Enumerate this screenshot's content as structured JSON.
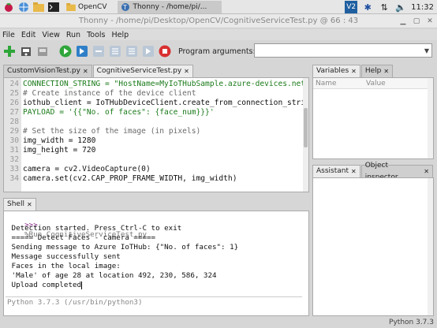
{
  "taskbar": {
    "tasks": [
      {
        "label": "OpenCV"
      },
      {
        "label": "Thonny  -  /home/pi/..."
      }
    ],
    "clock": "11:32"
  },
  "window": {
    "title": "Thonny  -  /home/pi/Desktop/OpenCV/CognitiveServiceTest.py  @  66 : 43"
  },
  "menu": [
    "File",
    "Edit",
    "View",
    "Run",
    "Tools",
    "Help"
  ],
  "toolbar": {
    "program_args_label": "Program arguments:",
    "program_args_value": ""
  },
  "editor": {
    "tabs": [
      {
        "label": "CustomVisionTest.py",
        "active": false
      },
      {
        "label": "CognitiveServiceTest.py",
        "active": true
      }
    ],
    "lines": [
      {
        "n": "24",
        "text": "CONNECTION_STRING = \"HostName=MyIoTHubSample.azure-devices.net;D",
        "kind": "string"
      },
      {
        "n": "25",
        "text": "# Create instance of the device client",
        "kind": "comment"
      },
      {
        "n": "26",
        "text": "iothub_client = IoTHubDeviceClient.create_from_connection_string",
        "kind": "default"
      },
      {
        "n": "27",
        "text": "PAYLOAD = '{{\"No. of faces\": {face_num}}}'",
        "kind": "string"
      },
      {
        "n": "28",
        "text": "",
        "kind": "default"
      },
      {
        "n": "29",
        "text": "# Set the size of the image (in pixels)",
        "kind": "comment"
      },
      {
        "n": "30",
        "text": "img_width = 1280",
        "kind": "default"
      },
      {
        "n": "31",
        "text": "img_height = 720",
        "kind": "default"
      },
      {
        "n": "32",
        "text": "",
        "kind": "default"
      },
      {
        "n": "33",
        "text": "camera = cv2.VideoCapture(0)",
        "kind": "default"
      },
      {
        "n": "34",
        "text": "camera.set(cv2.CAP_PROP_FRAME_WIDTH, img_width)",
        "kind": "default"
      }
    ]
  },
  "variables": {
    "tabs": [
      {
        "label": "Variables"
      },
      {
        "label": "Help"
      }
    ],
    "columns": [
      "Name",
      "Value"
    ]
  },
  "assistant": {
    "tabs": [
      {
        "label": "Assistant"
      },
      {
        "label": "Object inspector"
      }
    ]
  },
  "shell": {
    "tab": "Shell",
    "prompt": ">>>",
    "run_command": "%Run CognitiveServiceTest.py",
    "output": [
      " Detection started. Press Ctrl-C to exit",
      " ===== Detect Faces - camera =====",
      " Sending message to Azure IoTHub: {\"No. of faces\": 1}",
      " Message successfully sent",
      " Faces in the local image:",
      " 'Male' of age 28 at location 492, 230, 586, 324",
      " Upload completed"
    ],
    "version_line": "Python 3.7.3 (/usr/bin/python3)",
    "final_prompt": ">>>"
  },
  "status": {
    "python_version": "Python 3.7.3"
  }
}
